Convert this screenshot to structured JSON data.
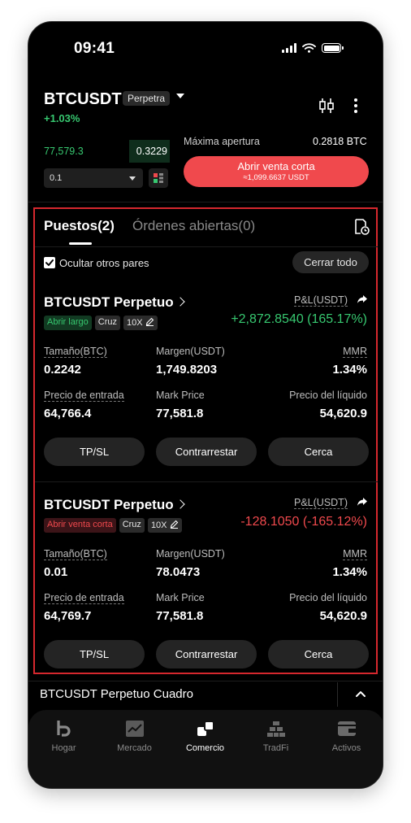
{
  "status_bar": {
    "time": "09:41"
  },
  "header": {
    "pair": "BTCUSDT",
    "contract_type": "Perpetra",
    "change": "+1.03%"
  },
  "orderbook": {
    "price": "77,579.3",
    "size": "0.3229"
  },
  "order_form": {
    "quantity_value": "0.1",
    "max_open_label": "Máxima apertura",
    "max_open_value": "0.2818 BTC",
    "short_button_label": "Abrir venta corta",
    "short_button_sub": "≈1,099.6637 USDT"
  },
  "tabs": {
    "positions": "Puestos(2)",
    "open_orders": "Órdenes abiertas(0)"
  },
  "filter": {
    "hide_other_pairs": "Ocultar otros pares",
    "close_all": "Cerrar todo"
  },
  "positions": [
    {
      "title": "BTCUSDT Perpetuo",
      "side": "Abrir largo",
      "margin_mode": "Cruz",
      "leverage": "10X",
      "pnl_label": "P&L(USDT)",
      "pnl_value": "+2,872.8540 (165.17%)",
      "size_label": "Tamaño(BTC)",
      "size_value": "0.2242",
      "margin_label": "Margen(USDT)",
      "margin_value": "1,749.8203",
      "mmr_label": "MMR",
      "mmr_value": "1.34%",
      "entry_label": "Precio de entrada",
      "entry_value": "64,766.4",
      "mark_label": "Mark Price",
      "mark_value": "77,581.8",
      "liq_label": "Precio del líquido",
      "liq_value": "54,620.9",
      "btn_tpsl": "TP/SL",
      "btn_counter": "Contrarrestar",
      "btn_close": "Cerca"
    },
    {
      "title": "BTCUSDT Perpetuo",
      "side": "Abrir venta corta",
      "margin_mode": "Cruz",
      "leverage": "10X",
      "pnl_label": "P&L(USDT)",
      "pnl_value": "-128.1050 (-165.12%)",
      "size_label": "Tamaño(BTC)",
      "size_value": "0.01",
      "margin_label": "Margen(USDT)",
      "margin_value": "78.0473",
      "mmr_label": "MMR",
      "mmr_value": "1.34%",
      "entry_label": "Precio de entrada",
      "entry_value": "64,769.7",
      "mark_label": "Mark Price",
      "mark_value": "77,581.8",
      "liq_label": "Precio del líquido",
      "liq_value": "54,620.9",
      "btn_tpsl": "TP/SL",
      "btn_counter": "Contrarrestar",
      "btn_close": "Cerca"
    }
  ],
  "chart_bar": {
    "label": "BTCUSDT Perpetuo Cuadro"
  },
  "bottom_nav": [
    {
      "label": "Hogar",
      "icon": "home-icon"
    },
    {
      "label": "Mercado",
      "icon": "market-chart-icon"
    },
    {
      "label": "Comercio",
      "icon": "trade-icon",
      "active": true
    },
    {
      "label": "TradFi",
      "icon": "tradfi-bars-icon"
    },
    {
      "label": "Activos",
      "icon": "wallet-icon"
    }
  ],
  "colors": {
    "up": "#37c870",
    "down": "#f0494d",
    "highlight_frame": "#d6282e",
    "background": "#000000"
  }
}
